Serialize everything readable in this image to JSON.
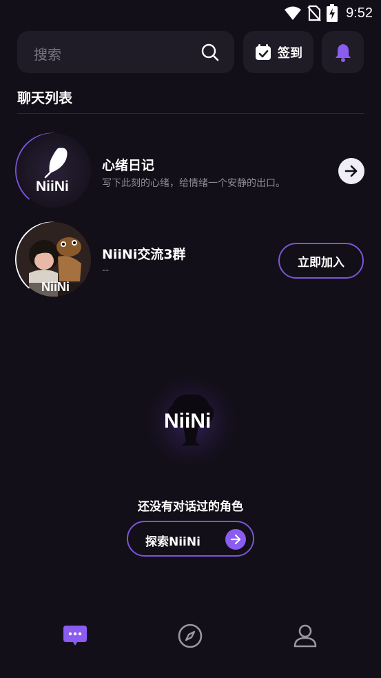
{
  "status_bar": {
    "time": "9:52"
  },
  "search": {
    "placeholder": "搜索"
  },
  "checkin": {
    "label": "签到"
  },
  "section": {
    "title": "聊天列表"
  },
  "chats": [
    {
      "name": "心绪日记",
      "subtitle": "写下此刻的心绪，给情绪一个安静的出口。",
      "logo_text": "NiiNi"
    },
    {
      "name": "NiiNi交流3群",
      "subtitle": "--",
      "action_label": "立即加入",
      "logo_text": "NiiNi"
    }
  ],
  "empty_state": {
    "logo_text": "NiiNi",
    "message": "还没有对话过的角色",
    "button_label": "探索NiiNi"
  },
  "colors": {
    "accent": "#8a5cf0",
    "background": "#130f19",
    "card": "#1f1b27",
    "inactive_icon": "#9a97a1"
  },
  "bottom_nav": {
    "items": [
      "chat-icon",
      "compass-icon",
      "user-icon"
    ],
    "active": "chat-icon"
  }
}
